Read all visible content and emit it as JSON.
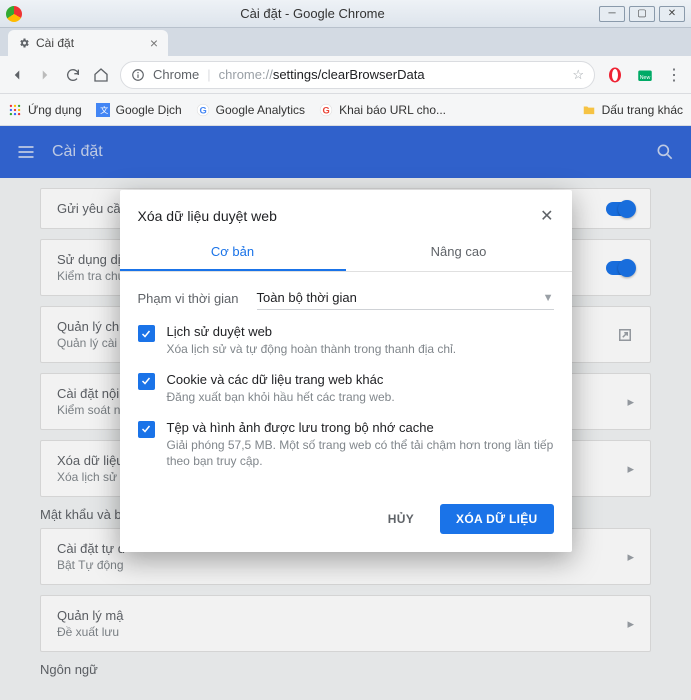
{
  "window": {
    "title": "Cài đặt - Google Chrome"
  },
  "tab": {
    "title": "Cài đặt"
  },
  "omnibox": {
    "brand": "Chrome",
    "url_prefix": "chrome://",
    "url_path": "settings/clearBrowserData"
  },
  "bookmarks": {
    "apps": "Ứng dụng",
    "items": [
      "Google Dịch",
      "Google Analytics",
      "Khai báo URL cho..."
    ],
    "other": "Dấu trang khác"
  },
  "settings": {
    "title": "Cài đặt",
    "rows": [
      {
        "title": "Gửi yêu cầu"
      },
      {
        "title": "Sử dụng dịch",
        "sub": "Kiểm tra chú"
      },
      {
        "title": "Quản lý chứ",
        "sub": "Quản lý cài"
      },
      {
        "title": "Cài đặt nội",
        "sub": "Kiểm soát n"
      },
      {
        "title": "Xóa dữ liệu",
        "sub": "Xóa lịch sử"
      }
    ],
    "section_a": "Mật khẩu và b",
    "rows2": [
      {
        "title": "Cài đặt tự đ",
        "sub": "Bật Tự động"
      },
      {
        "title": "Quản lý mậ",
        "sub": "Đề xuất lưu"
      }
    ],
    "section_b": "Ngôn ngữ"
  },
  "dialog": {
    "title": "Xóa dữ liệu duyệt web",
    "tabs": {
      "basic": "Cơ bản",
      "advanced": "Nâng cao"
    },
    "time_label": "Phạm vi thời gian",
    "time_value": "Toàn bộ thời gian",
    "options": [
      {
        "title": "Lịch sử duyệt web",
        "sub": "Xóa lịch sử và tự động hoàn thành trong thanh địa chỉ."
      },
      {
        "title": "Cookie và các dữ liệu trang web khác",
        "sub": "Đăng xuất bạn khỏi hầu hết các trang web."
      },
      {
        "title": "Tệp và hình ảnh được lưu trong bộ nhớ cache",
        "sub": "Giải phóng 57,5 MB. Một số trang web có thể tải chậm hơn trong lần tiếp theo bạn truy cập."
      }
    ],
    "actions": {
      "cancel": "HỦY",
      "confirm": "XÓA DỮ LIỆU"
    }
  }
}
